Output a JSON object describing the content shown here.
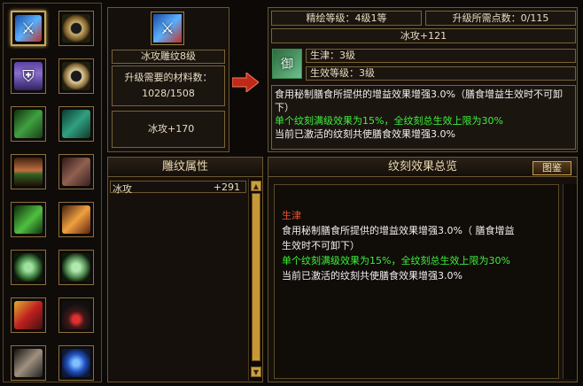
{
  "selected_item": {
    "name": "冰攻雕纹8级",
    "material_label": "升级需要的材料数：",
    "material_count": "1028/1508",
    "bonus": "冰攻+170"
  },
  "engrave": {
    "level": "精绘等级：4级1等",
    "points": "升级所需点数：0/115",
    "stat": "冰攻+121",
    "law_name": "生津：3级",
    "effect_level": "生效等级：3级",
    "desc_white": "食用秘制膳食所提供的增益效果增强3.0%（膳食增益生效时不可卸下）",
    "desc_green": "单个纹刻满级效果为15%，全纹刻总生效上限为30%",
    "desc_active": "当前已激活的纹刻共使膳食效果增强3.0%"
  },
  "attributes": {
    "header": "雕纹属性",
    "rows": [
      {
        "name": "冰攻",
        "value": "+291"
      }
    ]
  },
  "overview": {
    "header": "纹刻效果总览",
    "button": "图鉴",
    "title": "生津",
    "line1": "食用秘制膳食所提供的增益效果增强3.0%（ 膳食增益",
    "line2": "生效时不可卸下）",
    "line3": "单个纹刻满级效果为15%，全纹刻总生效上限为30%",
    "line4": "当前已激活的纹刻共使膳食效果增强3.0%"
  },
  "inventory_icons": [
    "ice-sword-icon",
    "ring-icon",
    "armor-icon",
    "ring-icon",
    "bracer-icon",
    "bracer-icon",
    "belt-icon",
    "boot-icon",
    "glove-icon",
    "scepter-icon",
    "jade-pendant-icon",
    "jade-pendant-icon",
    "charm-icon",
    "necklace-icon",
    "dagger-icon",
    "ice-orb-icon"
  ],
  "colors": {
    "gold_border": "#7a6235",
    "green_text": "#3cf03c",
    "red_text": "#e85030"
  }
}
